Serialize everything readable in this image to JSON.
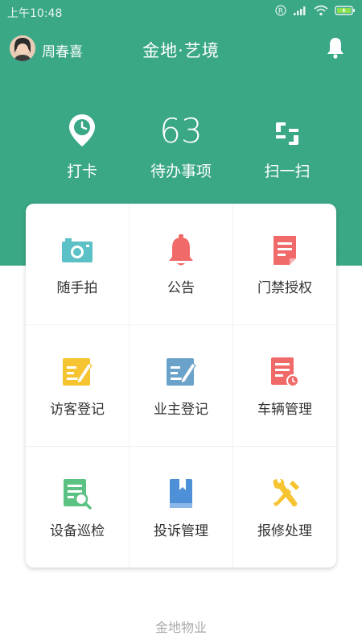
{
  "status_bar": {
    "time": "上午10:48",
    "icons": [
      "registered-icon",
      "signal-icon",
      "wifi-icon",
      "battery-charging-icon"
    ]
  },
  "header": {
    "user_name": "周春喜",
    "app_title": "金地·艺境",
    "bell_icon": "bell-icon"
  },
  "quick_actions": [
    {
      "label": "打卡",
      "icon": "location-clock-icon"
    },
    {
      "label": "待办事项",
      "value": "63"
    },
    {
      "label": "扫一扫",
      "icon": "scan-icon"
    }
  ],
  "grid": [
    {
      "label": "随手拍",
      "icon": "camera-icon",
      "color": "#5cc1c7"
    },
    {
      "label": "公告",
      "icon": "bell-icon",
      "color": "#f16a6a"
    },
    {
      "label": "门禁授权",
      "icon": "document-icon",
      "color": "#f16a6a"
    },
    {
      "label": "访客登记",
      "icon": "edit-note-icon",
      "color": "#f6c431"
    },
    {
      "label": "业主登记",
      "icon": "edit-note-icon",
      "color": "#6aa2c9"
    },
    {
      "label": "车辆管理",
      "icon": "document-clock-icon",
      "color": "#f16a6a"
    },
    {
      "label": "设备巡检",
      "icon": "document-search-icon",
      "color": "#5cc283"
    },
    {
      "label": "投诉管理",
      "icon": "book-icon",
      "color": "#4e90d8"
    },
    {
      "label": "报修处理",
      "icon": "wrench-icon",
      "color": "#f6c431"
    }
  ],
  "footer": {
    "text": "金地物业"
  },
  "colors": {
    "brand": "#3aa786",
    "background": "#ffffff"
  }
}
